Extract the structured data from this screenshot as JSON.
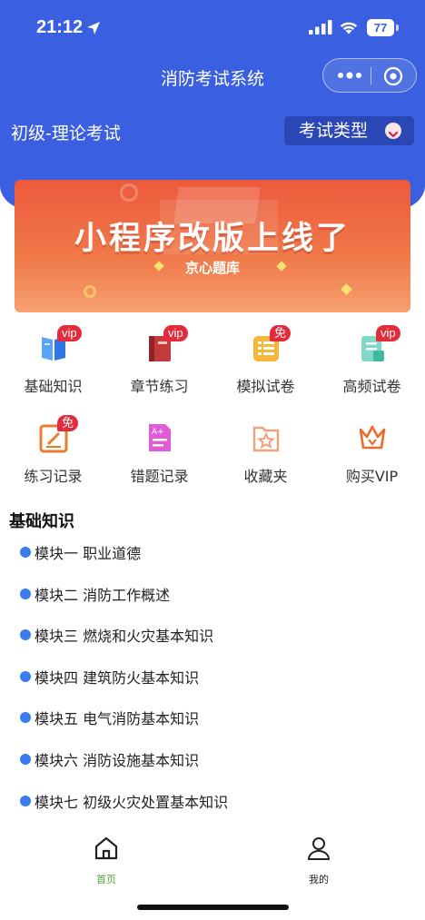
{
  "status_bar": {
    "time": "21:12",
    "battery": "77"
  },
  "nav": {
    "title": "消防考试系统"
  },
  "exam": {
    "title": "初级-理论考试",
    "type_button": "考试类型"
  },
  "banner": {
    "title": "小程序改版上线了",
    "subtitle": "京心题库"
  },
  "menu": [
    {
      "label": "基础知识",
      "badge": "vip",
      "icon": "book-icon"
    },
    {
      "label": "章节练习",
      "badge": "vip",
      "icon": "notebook-icon"
    },
    {
      "label": "模拟试卷",
      "badge": "免",
      "icon": "exam-paper-icon"
    },
    {
      "label": "高频试卷",
      "badge": "vip",
      "icon": "document-icon"
    },
    {
      "label": "练习记录",
      "badge": "免",
      "icon": "edit-record-icon"
    },
    {
      "label": "错题记录",
      "badge": "",
      "icon": "wrong-answer-icon"
    },
    {
      "label": "收藏夹",
      "badge": "",
      "icon": "star-folder-icon"
    },
    {
      "label": "购买VIP",
      "badge": "",
      "icon": "crown-icon"
    }
  ],
  "section": {
    "title": "基础知识",
    "modules": [
      "模块一 职业道德",
      "模块二 消防工作概述",
      "模块三 燃烧和火灾基本知识",
      "模块四 建筑防火基本知识",
      "模块五 电气消防基本知识",
      "模块六 消防设施基本知识",
      "模块七 初级火灾处置基本知识"
    ]
  },
  "tabbar": {
    "home": "首页",
    "mine": "我的",
    "active_color": "#4aa53a",
    "inactive_color": "#222222"
  },
  "colors": {
    "brand_blue": "#3a5fe0",
    "bullet_blue": "#3a7cf0",
    "badge_red": "#e22c3c"
  }
}
